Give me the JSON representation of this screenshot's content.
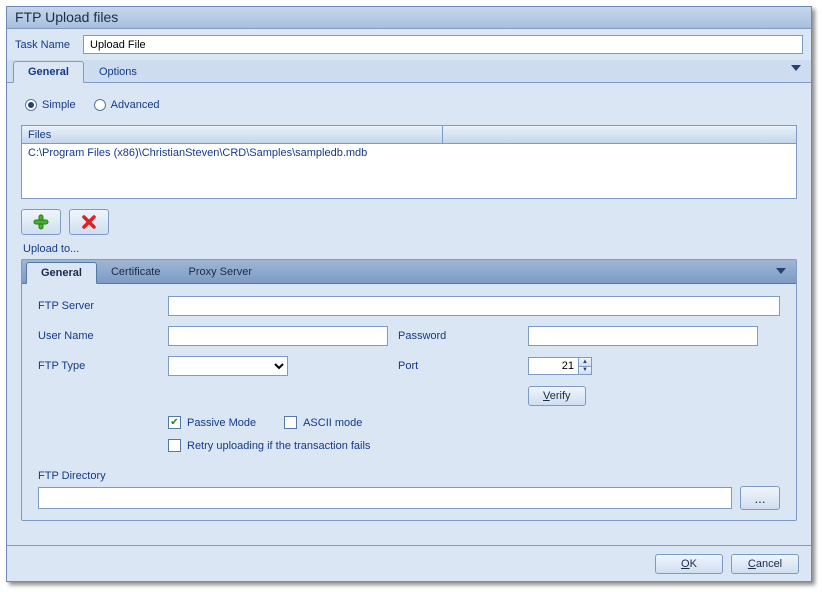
{
  "window": {
    "title": "FTP Upload files"
  },
  "task": {
    "label": "Task Name",
    "value": "Upload File"
  },
  "tabs": {
    "general": "General",
    "options": "Options"
  },
  "mode": {
    "simple": "Simple",
    "advanced": "Advanced"
  },
  "files": {
    "header": "Files",
    "rows": [
      "C:\\Program Files (x86)\\ChristianSteven\\CRD\\Samples\\sampledb.mdb"
    ]
  },
  "upload": {
    "label": "Upload to...",
    "tabs": {
      "general": "General",
      "certificate": "Certificate",
      "proxy": "Proxy Server"
    },
    "fields": {
      "ftp_server": "FTP Server",
      "user_name": "User Name",
      "password": "Password",
      "ftp_type": "FTP Type",
      "port": "Port",
      "port_value": "21",
      "verify": "Verify"
    },
    "checks": {
      "passive": "Passive Mode",
      "ascii": "ASCII mode",
      "retry": "Retry uploading if the transaction fails"
    },
    "directory": {
      "label": "FTP Directory",
      "browse": "..."
    }
  },
  "footer": {
    "ok": "OK",
    "cancel": "Cancel"
  }
}
